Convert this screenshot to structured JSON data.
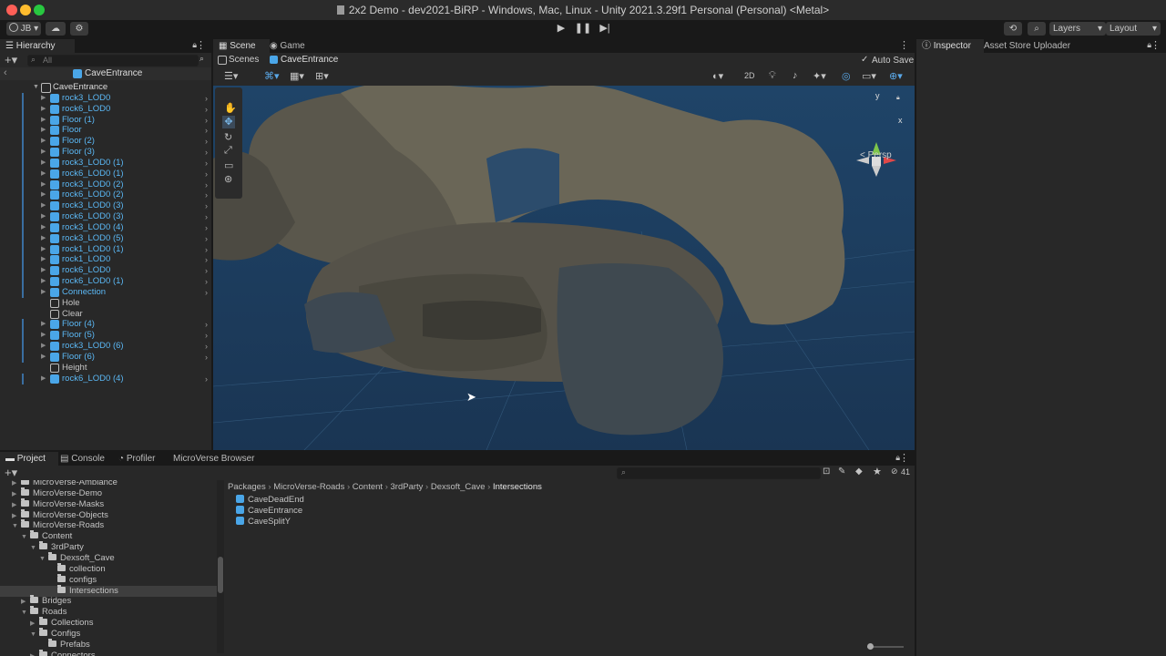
{
  "window": {
    "title": "2x2 Demo - dev2021-BiRP - Windows, Mac, Linux - Unity 2021.3.29f1 Personal (Personal) <Metal>"
  },
  "toolbar": {
    "account": "JB",
    "layers": "Layers",
    "layout": "Layout"
  },
  "hierarchy": {
    "tab": "Hierarchy",
    "search_placeholder": "All",
    "breadcrumb": "CaveEntrance",
    "root": "CaveEntrance",
    "items": [
      {
        "label": "rock3_LOD0",
        "prefab": true
      },
      {
        "label": "rock6_LOD0",
        "prefab": true
      },
      {
        "label": "Floor (1)",
        "prefab": true
      },
      {
        "label": "Floor",
        "prefab": true
      },
      {
        "label": "Floor (2)",
        "prefab": true
      },
      {
        "label": "Floor (3)",
        "prefab": true
      },
      {
        "label": "rock3_LOD0 (1)",
        "prefab": true
      },
      {
        "label": "rock6_LOD0 (1)",
        "prefab": true
      },
      {
        "label": "rock3_LOD0 (2)",
        "prefab": true
      },
      {
        "label": "rock6_LOD0 (2)",
        "prefab": true
      },
      {
        "label": "rock3_LOD0 (3)",
        "prefab": true
      },
      {
        "label": "rock6_LOD0 (3)",
        "prefab": true
      },
      {
        "label": "rock3_LOD0 (4)",
        "prefab": true
      },
      {
        "label": "rock3_LOD0 (5)",
        "prefab": true
      },
      {
        "label": "rock1_LOD0 (1)",
        "prefab": true
      },
      {
        "label": "rock1_LOD0",
        "prefab": true
      },
      {
        "label": "rock6_LOD0",
        "prefab": true
      },
      {
        "label": "rock6_LOD0 (1)",
        "prefab": true
      },
      {
        "label": "Connection",
        "prefab": true
      },
      {
        "label": "Hole",
        "prefab": false
      },
      {
        "label": "Clear",
        "prefab": false
      },
      {
        "label": "Floor (4)",
        "prefab": true
      },
      {
        "label": "Floor (5)",
        "prefab": true
      },
      {
        "label": "rock3_LOD0 (6)",
        "prefab": true
      },
      {
        "label": "Floor (6)",
        "prefab": true
      },
      {
        "label": "Height",
        "prefab": false
      },
      {
        "label": "rock6_LOD0 (4)",
        "prefab": true
      }
    ]
  },
  "scene": {
    "tabs": [
      "Scene",
      "Game"
    ],
    "breadcrumb_root": "Scenes",
    "breadcrumb_current": "CaveEntrance",
    "auto_save": "Auto Save",
    "mode_2d": "2D",
    "persp": "< Persp",
    "gizmo_y": "y",
    "gizmo_x": "x"
  },
  "inspector": {
    "tabs": [
      "Inspector",
      "Asset Store Uploader"
    ]
  },
  "project": {
    "tabs": [
      "Project",
      "Console",
      "Profiler",
      "MicroVerse Browser"
    ],
    "badge": "41",
    "tree": [
      {
        "label": "MicroVerse-Ambiance",
        "depth": 0,
        "open": false
      },
      {
        "label": "MicroVerse-Demo",
        "depth": 0,
        "open": false
      },
      {
        "label": "MicroVerse-Masks",
        "depth": 0,
        "open": false
      },
      {
        "label": "MicroVerse-Objects",
        "depth": 0,
        "open": false
      },
      {
        "label": "MicroVerse-Roads",
        "depth": 0,
        "open": true
      },
      {
        "label": "Content",
        "depth": 1,
        "open": true
      },
      {
        "label": "3rdParty",
        "depth": 2,
        "open": true
      },
      {
        "label": "Dexsoft_Cave",
        "depth": 3,
        "open": true
      },
      {
        "label": "collection",
        "depth": 4,
        "open": null
      },
      {
        "label": "configs",
        "depth": 4,
        "open": null
      },
      {
        "label": "Intersections",
        "depth": 4,
        "open": null,
        "selected": true
      },
      {
        "label": "Bridges",
        "depth": 1,
        "open": false
      },
      {
        "label": "Roads",
        "depth": 1,
        "open": true
      },
      {
        "label": "Collections",
        "depth": 2,
        "open": false
      },
      {
        "label": "Configs",
        "depth": 2,
        "open": true
      },
      {
        "label": "Prefabs",
        "depth": 3,
        "open": null
      },
      {
        "label": "Connectors",
        "depth": 2,
        "open": false
      }
    ],
    "path": [
      "Packages",
      "MicroVerse-Roads",
      "Content",
      "3rdParty",
      "Dexsoft_Cave",
      "Intersections"
    ],
    "assets": [
      "CaveDeadEnd",
      "CaveEntrance",
      "CaveSplitY"
    ]
  },
  "colors": {
    "accent": "#5bb8f5",
    "panel": "#282828",
    "scene_bg": "#1d3a5a"
  }
}
